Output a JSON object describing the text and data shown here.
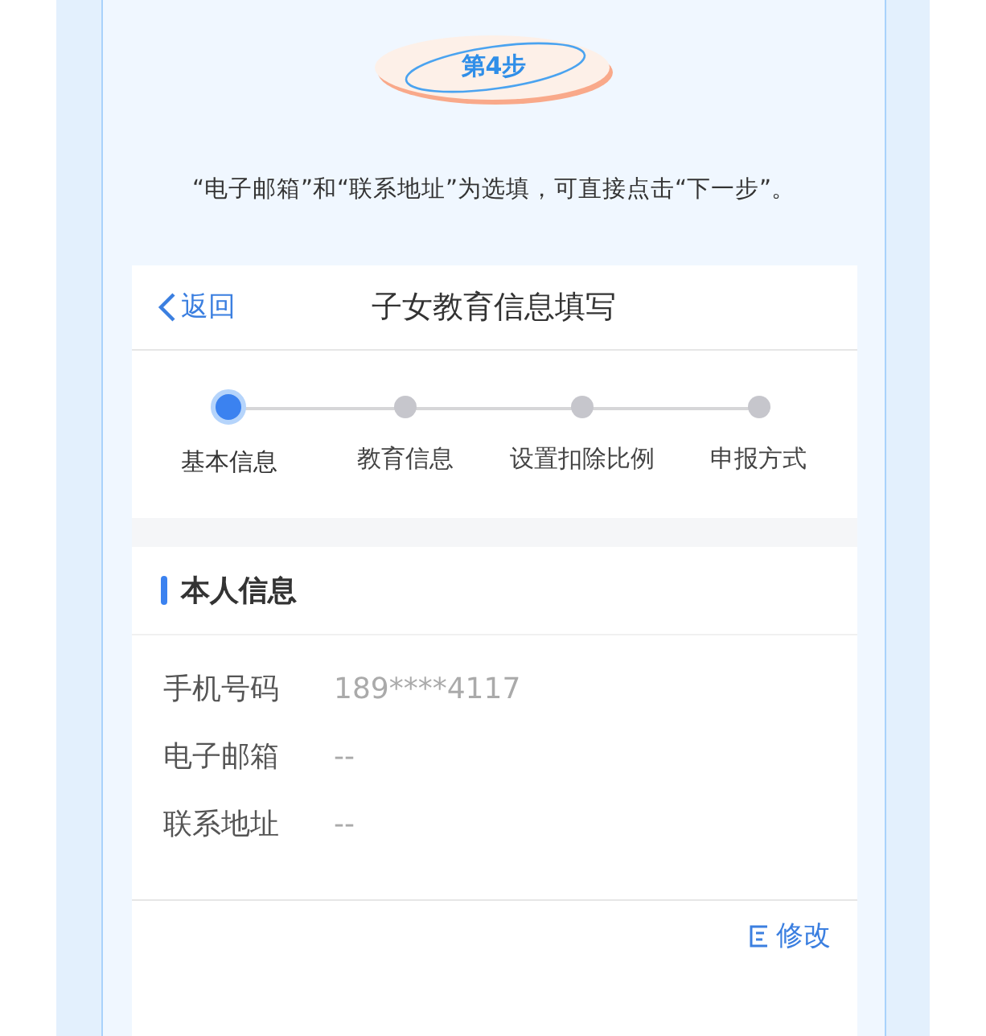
{
  "step_badge": "第4步",
  "instruction": "“电子邮箱”和“联系地址”为选填，可直接点击“下一步”。",
  "phone": {
    "back": "返回",
    "title": "子女教育信息填写",
    "steps": [
      {
        "label": "基本信息",
        "selected": true
      },
      {
        "label": "教育信息",
        "selected": false
      },
      {
        "label": "设置扣除比例",
        "selected": false
      },
      {
        "label": "申报方式",
        "selected": false
      }
    ],
    "section_title": "本人信息",
    "fields": [
      {
        "label": "手机号码",
        "value": "189****4117"
      },
      {
        "label": "电子邮箱",
        "value": "--"
      },
      {
        "label": "联系地址",
        "value": "--"
      }
    ],
    "edit": "修改"
  }
}
